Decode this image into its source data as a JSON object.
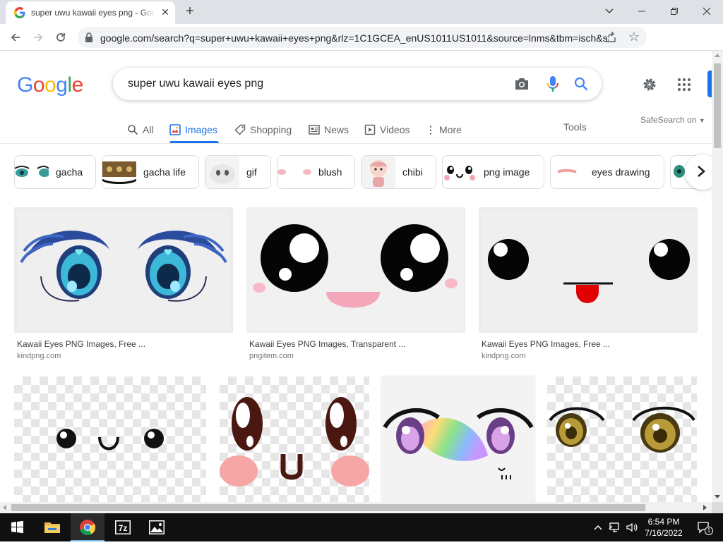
{
  "browser": {
    "tab_title": "super uwu kawaii eyes png - Google Search",
    "url": "google.com/search?q=super+uwu+kawaii+eyes+png&rlz=1C1GCEA_enUS1011US1011&source=lnms&tbm=isch&sa=X"
  },
  "search": {
    "logo": [
      "G",
      "o",
      "o",
      "g",
      "l",
      "e"
    ],
    "logo_colors": [
      "#4285f4",
      "#ea4335",
      "#fbbc05",
      "#4285f4",
      "#34a853",
      "#ea4335"
    ],
    "query": "super uwu kawaii eyes png"
  },
  "tabs": [
    {
      "label": "All",
      "icon": "search-icon",
      "active": false
    },
    {
      "label": "Images",
      "icon": "image-icon",
      "active": true
    },
    {
      "label": "Shopping",
      "icon": "tag-icon",
      "active": false
    },
    {
      "label": "News",
      "icon": "news-icon",
      "active": false
    },
    {
      "label": "Videos",
      "icon": "play-icon",
      "active": false
    },
    {
      "label": "More",
      "icon": "kebab-icon",
      "active": false
    }
  ],
  "tools_label": "Tools",
  "safesearch_label": "SafeSearch on",
  "chips": [
    {
      "label": "gacha"
    },
    {
      "label": "gacha life"
    },
    {
      "label": "gif"
    },
    {
      "label": "blush"
    },
    {
      "label": "chibi"
    },
    {
      "label": "png image"
    },
    {
      "label": "eyes drawing"
    }
  ],
  "results": [
    {
      "caption": "Kawaii Eyes PNG Images, Free ...",
      "source": "kindpng.com"
    },
    {
      "caption": "Kawaii Eyes PNG Images, Transparent ...",
      "source": "pngitem.com"
    },
    {
      "caption": "Kawaii Eyes PNG Images, Free ...",
      "source": "kindpng.com"
    }
  ],
  "taskbar": {
    "time": "6:54 PM",
    "date": "7/16/2022",
    "notification_count": "1"
  },
  "colors": {
    "accent": "#1a73e8",
    "taskbar": "#101010"
  }
}
